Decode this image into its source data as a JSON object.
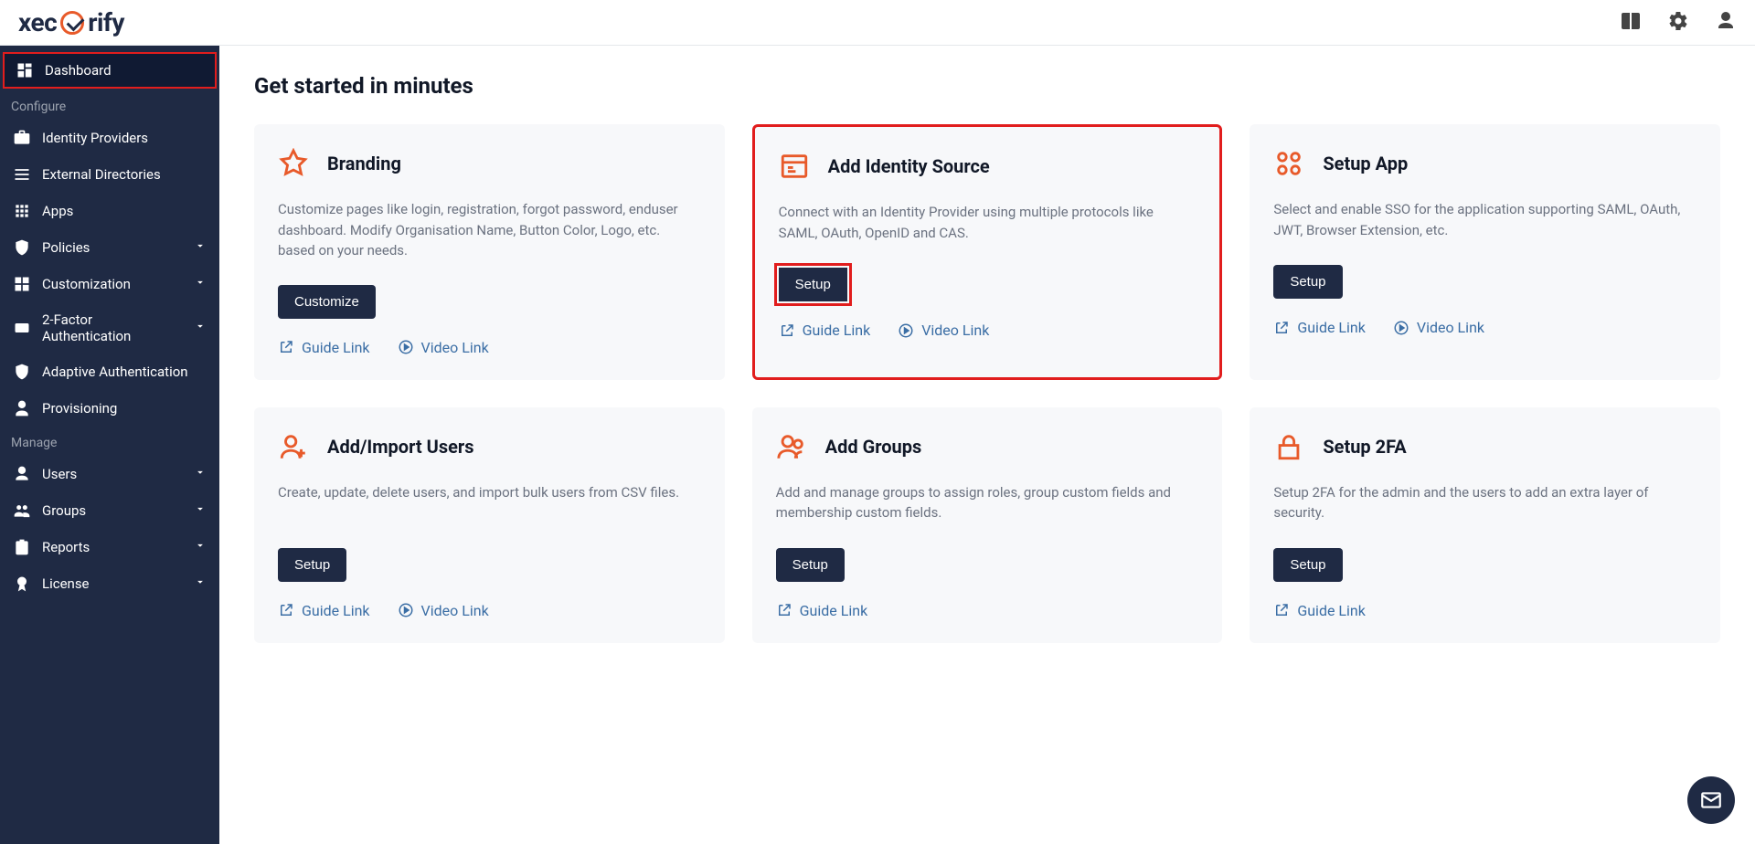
{
  "logo": {
    "pre": "xec",
    "post": "rify"
  },
  "sidebar": {
    "dashboard": "Dashboard",
    "section_configure": "Configure",
    "identity_providers": "Identity Providers",
    "external_directories": "External Directories",
    "apps": "Apps",
    "policies": "Policies",
    "customization": "Customization",
    "two_factor": "2-Factor Authentication",
    "adaptive_auth": "Adaptive Authentication",
    "provisioning": "Provisioning",
    "section_manage": "Manage",
    "users": "Users",
    "groups": "Groups",
    "reports": "Reports",
    "license": "License"
  },
  "main_title": "Get started in minutes",
  "cards": {
    "branding": {
      "title": "Branding",
      "desc": "Customize pages like login, registration, forgot password, enduser dashboard. Modify Organisation Name, Button Color, Logo, etc. based on your needs.",
      "btn": "Customize",
      "guide": "Guide Link",
      "video": "Video Link"
    },
    "identity": {
      "title": "Add Identity Source",
      "desc": "Connect with an Identity Provider using multiple protocols like SAML, OAuth, OpenID and CAS.",
      "btn": "Setup",
      "guide": "Guide Link",
      "video": "Video Link"
    },
    "setup_app": {
      "title": "Setup App",
      "desc": "Select and enable SSO for the application supporting SAML, OAuth, JWT, Browser Extension, etc.",
      "btn": "Setup",
      "guide": "Guide Link",
      "video": "Video Link"
    },
    "add_users": {
      "title": "Add/Import Users",
      "desc": "Create, update, delete users, and import bulk users from CSV files.",
      "btn": "Setup",
      "guide": "Guide Link",
      "video": "Video Link"
    },
    "add_groups": {
      "title": "Add Groups",
      "desc": "Add and manage groups to assign roles, group custom fields and membership custom fields.",
      "btn": "Setup",
      "guide": "Guide Link"
    },
    "setup_2fa": {
      "title": "Setup 2FA",
      "desc": "Setup 2FA for the admin and the users to add an extra layer of security.",
      "btn": "Setup",
      "guide": "Guide Link"
    }
  }
}
